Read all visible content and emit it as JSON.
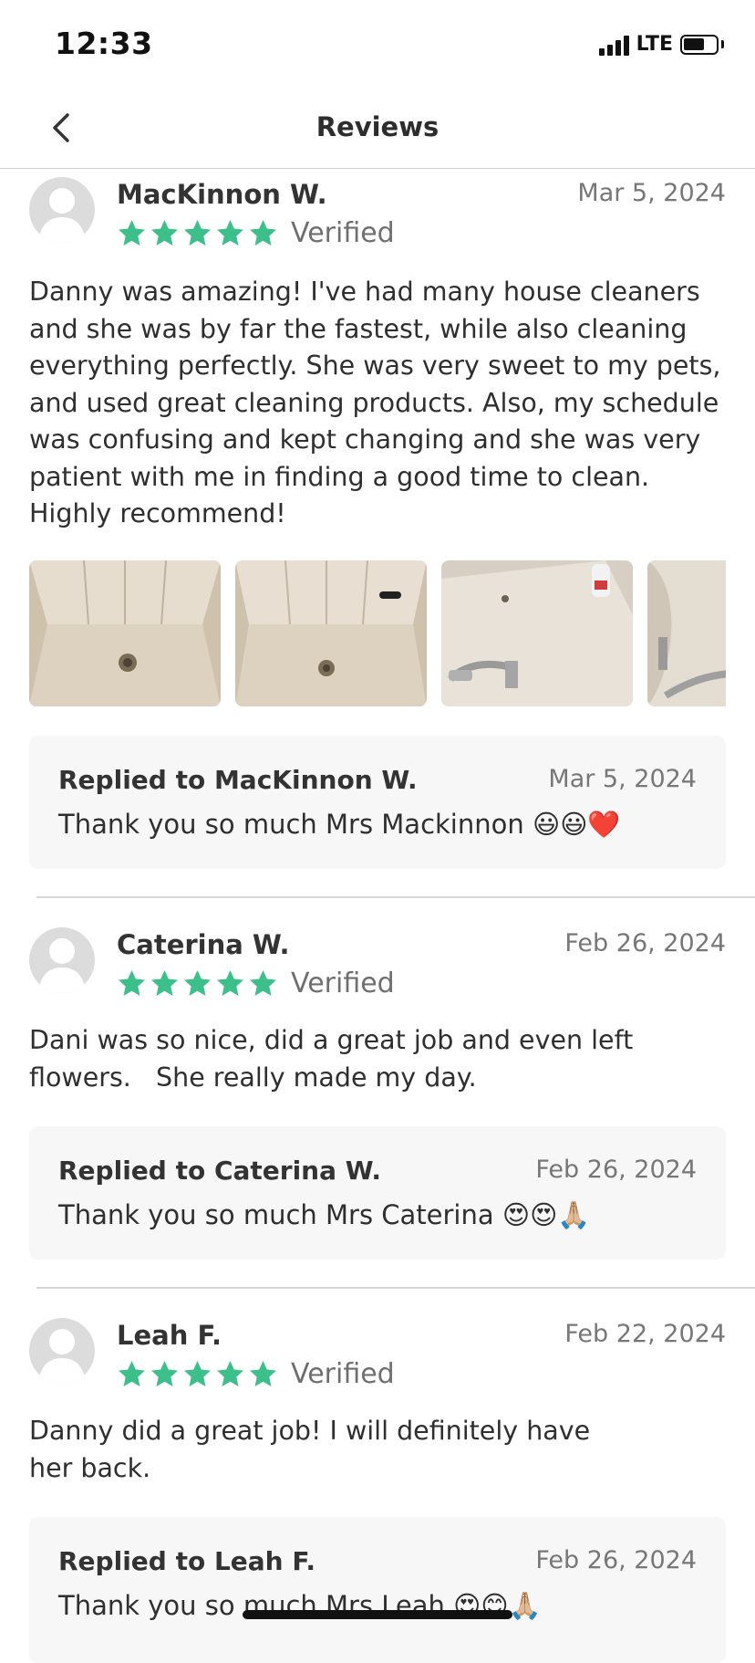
{
  "status_bar": {
    "time": "12:33",
    "network": "LTE"
  },
  "nav": {
    "title": "Reviews",
    "back_icon": "chevron-left-icon"
  },
  "colors": {
    "star": "#3dbf8b",
    "avatar": "#dcdcdc",
    "reply_bg": "#f7f7f7"
  },
  "reviews": [
    {
      "name": "MacKinnon W.",
      "date": "Mar 5, 2024",
      "rating": 5,
      "verified": "Verified",
      "text": "Danny was amazing! I've had many house cleaners and she was by far the fastest, while also cleaning everything perfectly. She was very sweet to my pets, and used great cleaning products. Also, my schedule was confusing and kept changing and she was very patient with me in finding a good time to clean. Highly recommend!",
      "photos": [
        "shower-floor-photo",
        "shower-floor-photo",
        "bathtub-photo",
        "bathtub-faucet-photo"
      ],
      "reply": {
        "title": "Replied to MacKinnon W.",
        "date": "Mar 5, 2024",
        "text": "Thank you so much Mrs Mackinnon 😃😃❤️"
      }
    },
    {
      "name": "Caterina W.",
      "date": "Feb 26, 2024",
      "rating": 5,
      "verified": "Verified",
      "text": "Dani was so nice, did a great job and even left flowers.   She really made my day.",
      "reply": {
        "title": "Replied to Caterina W.",
        "date": "Feb 26, 2024",
        "text": "Thank you so much Mrs Caterina 😍😍🙏🏼"
      }
    },
    {
      "name": "Leah F.",
      "date": "Feb 22, 2024",
      "rating": 5,
      "verified": "Verified",
      "text": "Danny did a great job! I will definitely have her back.",
      "reply": {
        "title": "Replied to Leah F.",
        "date": "Feb 26, 2024",
        "text": "Thank you so much Mrs Leah 😍😊🙏🏼"
      }
    }
  ]
}
